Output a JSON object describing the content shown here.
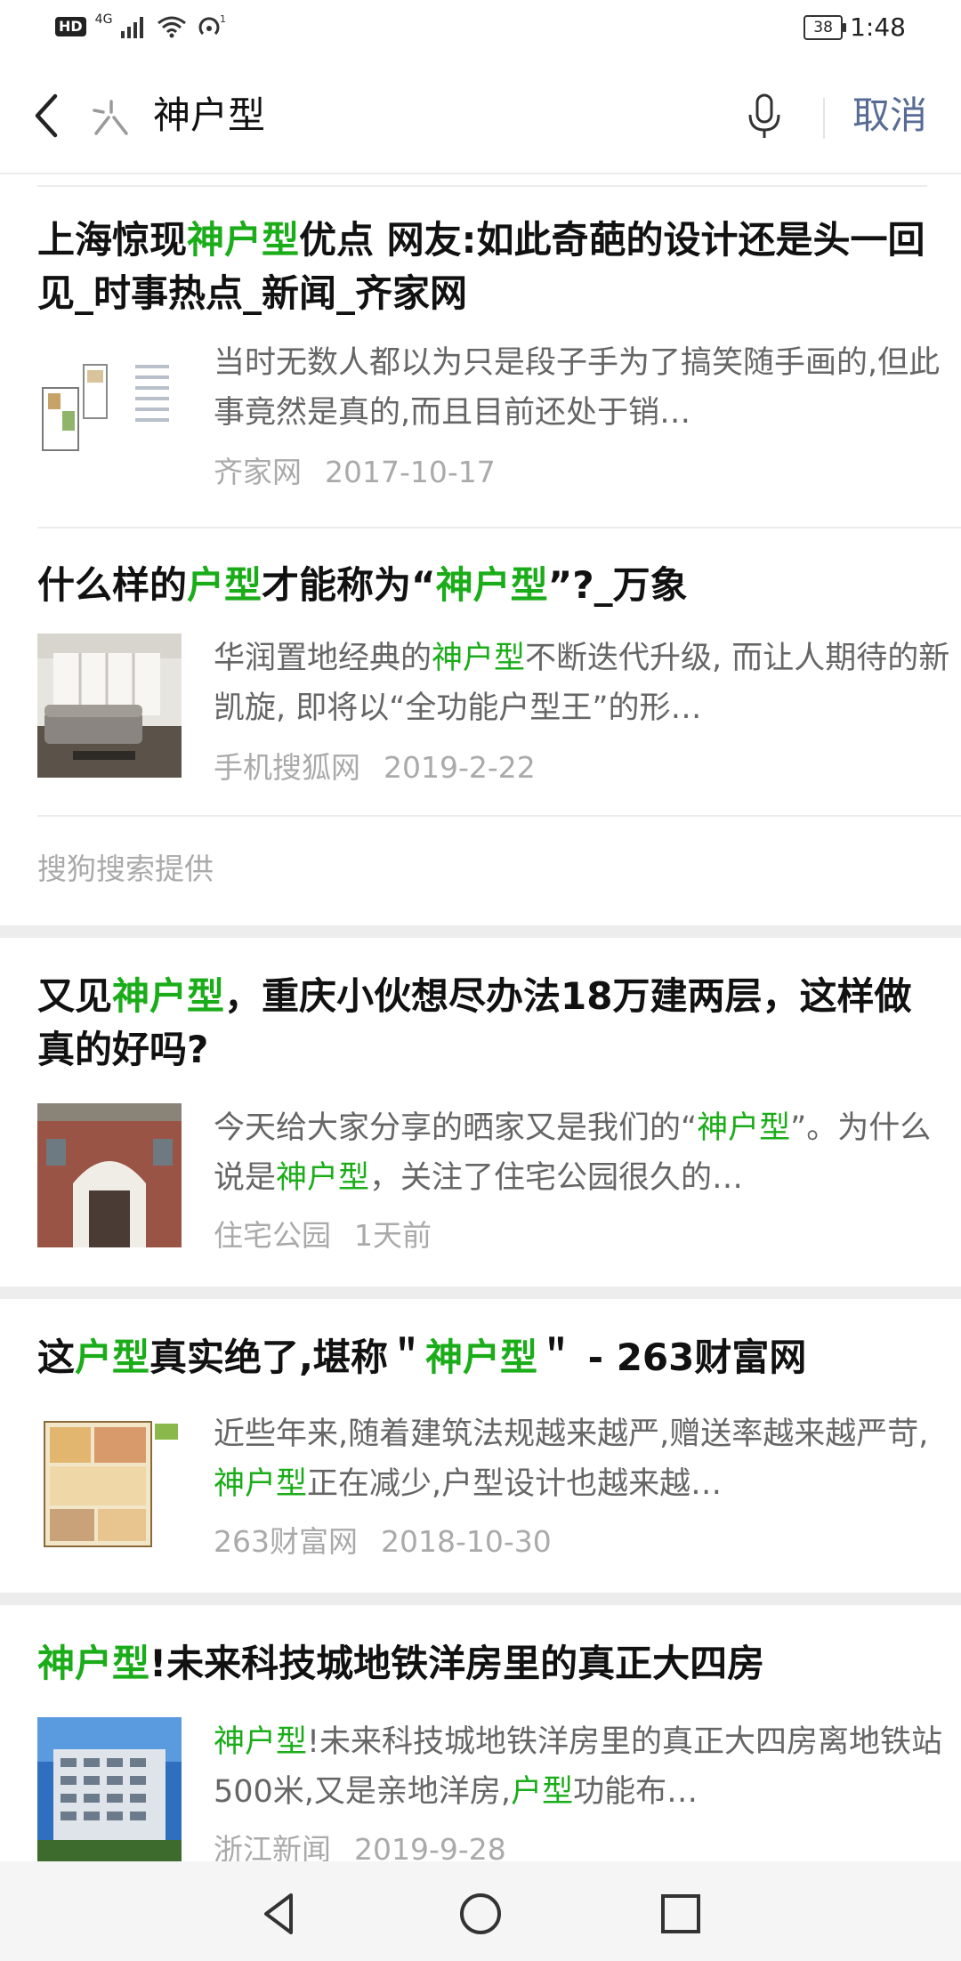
{
  "status_bar": {
    "hd": "HD",
    "network": "4G",
    "battery": "38",
    "time": "1:48"
  },
  "search": {
    "query": "神户型",
    "cancel_label": "取消"
  },
  "results_sogou": [
    {
      "title_parts": [
        [
          "上海惊现",
          false
        ],
        [
          "神户型",
          true
        ],
        [
          "优点 网友:如此奇葩的设计还是头一回见_时事热点_新闻_齐家网",
          false
        ]
      ],
      "snippet_parts": [
        [
          "当时无数人都以为只是段子手为了搞笑随手画的,但此事竟然是真的,而且目前还处于销…",
          false
        ]
      ],
      "source": "齐家网",
      "date": "2017-10-17",
      "thumb": "floor-plan"
    },
    {
      "title_parts": [
        [
          "什么样的",
          false
        ],
        [
          "户型",
          true
        ],
        [
          "才能称为“",
          false
        ],
        [
          "神户型",
          true
        ],
        [
          "”?_万象",
          false
        ]
      ],
      "snippet_parts": [
        [
          "华润置地经典的",
          false
        ],
        [
          "神户型",
          true
        ],
        [
          "不断迭代升级, 而让人期待的新凯旋, 即将以“全功能户型王”的形…",
          false
        ]
      ],
      "source": "手机搜狐网",
      "date": "2019-2-22",
      "thumb": "living-room"
    }
  ],
  "provided_by": "搜狗搜索提供",
  "results_more": [
    {
      "title_parts": [
        [
          "又见",
          false
        ],
        [
          "神户型",
          true
        ],
        [
          "，重庆小伙想尽办法18万建两层，这样做真的好吗?",
          false
        ]
      ],
      "snippet_parts": [
        [
          "今天给大家分享的晒家又是我们的“",
          false
        ],
        [
          "神户型",
          true
        ],
        [
          "”。为什么说是",
          false
        ],
        [
          "神户型",
          true
        ],
        [
          "，关注了住宅公园很久的…",
          false
        ]
      ],
      "source": "住宅公园",
      "date": "1天前",
      "thumb": "house"
    },
    {
      "title_parts": [
        [
          "这",
          false
        ],
        [
          "户型",
          true
        ],
        [
          "真实绝了,堪称＂",
          false
        ],
        [
          "神户型",
          true
        ],
        [
          "＂ - 263财富网",
          false
        ]
      ],
      "snippet_parts": [
        [
          "近些年来,随着建筑法规越来越严,赠送率越来越严苛,",
          false
        ],
        [
          "神户型",
          true
        ],
        [
          "正在减少,户型设计也越来越…",
          false
        ]
      ],
      "source": "263财富网",
      "date": "2018-10-30",
      "thumb": "color-plan"
    },
    {
      "title_parts": [
        [
          "神户型",
          true
        ],
        [
          "!未来科技城地铁洋房里的真正大四房",
          false
        ]
      ],
      "snippet_parts": [
        [
          "神户型",
          true
        ],
        [
          "!未来科技城地铁洋房里的真正大四房离地铁站500米,又是亲地洋房,",
          false
        ],
        [
          "户型",
          true
        ],
        [
          "功能布…",
          false
        ]
      ],
      "source": "浙江新闻",
      "date": "2019-9-28",
      "thumb": "building"
    }
  ],
  "icons": {
    "back": "back-arrow-icon",
    "logo": "search-logo-icon",
    "mic": "microphone-icon",
    "nav_back": "nav-back-icon",
    "nav_home": "nav-home-icon",
    "nav_recents": "nav-recents-icon"
  },
  "colors": {
    "highlight": "#1aad19",
    "cancel": "#576b95",
    "meta": "#aaaaaa",
    "snippet": "#666666",
    "band": "#ededed"
  }
}
